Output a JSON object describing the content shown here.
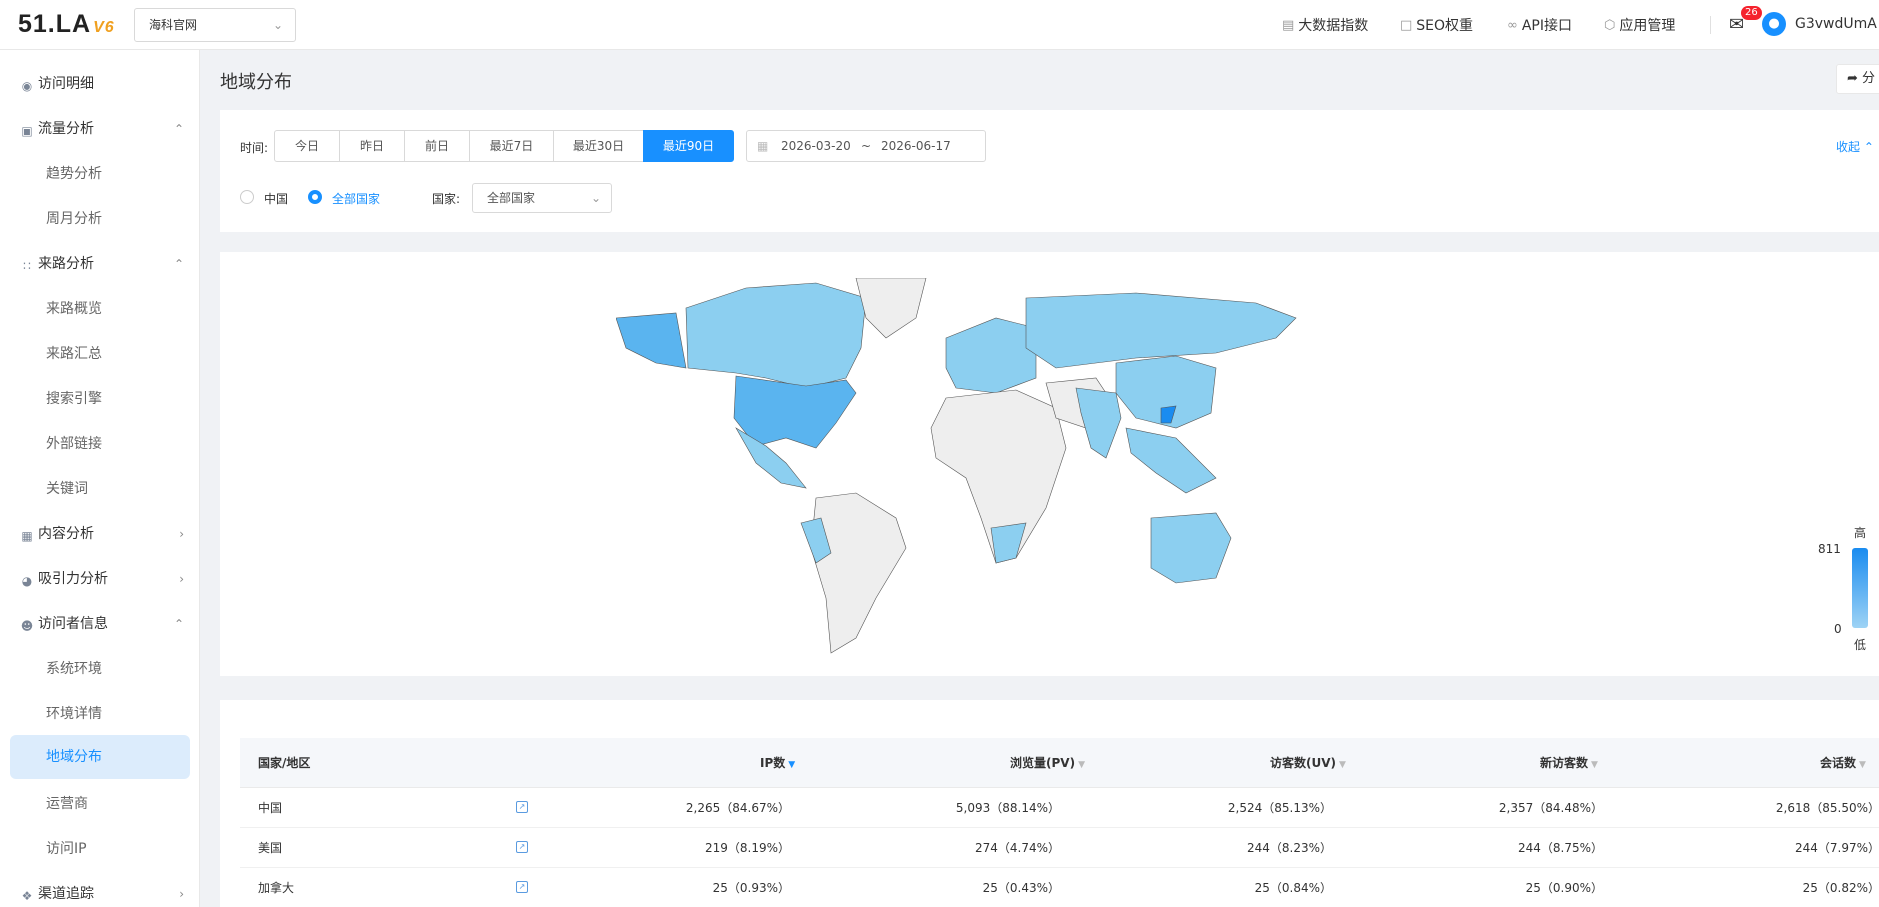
{
  "header": {
    "logo_text": "51.LA",
    "logo_version": "V6",
    "site_select": "海科官网",
    "nav": [
      "大数据指数",
      "SEO权重",
      "API接口",
      "应用管理"
    ],
    "mail_badge": "26",
    "username": "G3vwdUmA"
  },
  "sidebar": {
    "items": [
      {
        "label": "访问明细",
        "type": "item"
      },
      {
        "label": "流量分析",
        "type": "group",
        "expanded": true
      },
      {
        "label": "趋势分析",
        "type": "sub"
      },
      {
        "label": "周月分析",
        "type": "sub"
      },
      {
        "label": "来路分析",
        "type": "group",
        "expanded": true
      },
      {
        "label": "来路概览",
        "type": "sub"
      },
      {
        "label": "来路汇总",
        "type": "sub"
      },
      {
        "label": "搜索引擎",
        "type": "sub"
      },
      {
        "label": "外部链接",
        "type": "sub"
      },
      {
        "label": "关键词",
        "type": "sub"
      },
      {
        "label": "内容分析",
        "type": "group",
        "expanded": false
      },
      {
        "label": "吸引力分析",
        "type": "group",
        "expanded": false
      },
      {
        "label": "访问者信息",
        "type": "group",
        "expanded": true
      },
      {
        "label": "系统环境",
        "type": "sub"
      },
      {
        "label": "环境详情",
        "type": "sub"
      },
      {
        "label": "地域分布",
        "type": "sub",
        "active": true
      },
      {
        "label": "运营商",
        "type": "sub"
      },
      {
        "label": "访问IP",
        "type": "sub"
      },
      {
        "label": "渠道追踪",
        "type": "group",
        "expanded": false
      }
    ]
  },
  "page": {
    "title": "地域分布",
    "share_label": "分"
  },
  "filters": {
    "time_label": "时间:",
    "tabs": [
      "今日",
      "昨日",
      "前日",
      "最近7日",
      "最近30日",
      "最近90日"
    ],
    "active_tab": "最近90日",
    "date_start": "2026-03-20",
    "date_sep": "~",
    "date_end": "2026-06-17",
    "collapse_label": "收起",
    "region_options": [
      "中国",
      "全部国家"
    ],
    "region_selected": "全部国家",
    "country_label": "国家:",
    "country_value": "全部国家"
  },
  "map": {
    "legend_high": "高",
    "legend_low": "低",
    "legend_max": "811",
    "legend_min": "0",
    "color_high": "#1a8cf0",
    "color_low": "#9ed3f5"
  },
  "table": {
    "headers": [
      "国家/地区",
      "IP数",
      "浏览量(PV)",
      "访客数(UV)",
      "新访客数",
      "会话数"
    ],
    "sorted_column": "IP数",
    "rows": [
      {
        "region": "中国",
        "ip": "2,265（84.67%）",
        "pv": "5,093（88.14%）",
        "uv": "2,524（85.13%）",
        "new": "2,357（84.48%）",
        "sessions": "2,618（85.50%）"
      },
      {
        "region": "美国",
        "ip": "219（8.19%）",
        "pv": "274（4.74%）",
        "uv": "244（8.23%）",
        "new": "244（8.75%）",
        "sessions": "244（7.97%）"
      },
      {
        "region": "加拿大",
        "ip": "25（0.93%）",
        "pv": "25（0.43%）",
        "uv": "25（0.84%）",
        "new": "25（0.90%）",
        "sessions": "25（0.82%）"
      }
    ]
  }
}
